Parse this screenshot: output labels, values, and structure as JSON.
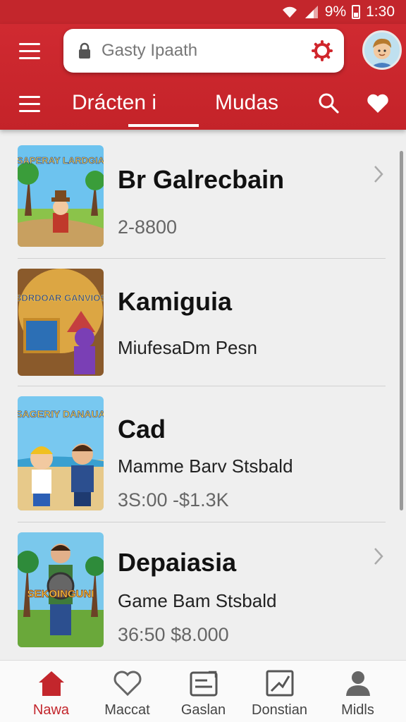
{
  "status_bar": {
    "battery": "9%",
    "time": "1:30"
  },
  "header": {
    "search": {
      "value": "Gasty Ipaath"
    },
    "tabs": [
      {
        "label": "Drácten i",
        "selected": true
      },
      {
        "label": "Mudas",
        "selected": false
      }
    ]
  },
  "items": [
    {
      "thumb_title": "SAPERAY LARDGIA",
      "title": "Br Galrecbain",
      "subtitle": "",
      "meta": "2-8800"
    },
    {
      "thumb_title": "BDRDOAR GANVIOS",
      "title": "Kamiguia",
      "subtitle": "MiufesaDm Pesn",
      "meta": ""
    },
    {
      "thumb_title": "SAGERIY DANAUA",
      "title": "Cad",
      "subtitle": "Mamme Barv Stsbald",
      "meta": "3S:00 -$1.3K"
    },
    {
      "thumb_title": "SEKOINGUNI",
      "title": "Depaiasia",
      "subtitle": "Game Bam Stsbald",
      "meta": "36:50 $8.000"
    }
  ],
  "bottom_nav": [
    {
      "label": "Nawa",
      "icon": "home-icon",
      "active": true
    },
    {
      "label": "Maccat",
      "icon": "heart-outline-icon",
      "active": false
    },
    {
      "label": "Gaslan",
      "icon": "document-edit-icon",
      "active": false
    },
    {
      "label": "Donstian",
      "icon": "chart-icon",
      "active": false
    },
    {
      "label": "Midls",
      "icon": "person-icon",
      "active": false
    }
  ],
  "colors": {
    "brand_red": "#c3262c",
    "background": "#efefef"
  }
}
